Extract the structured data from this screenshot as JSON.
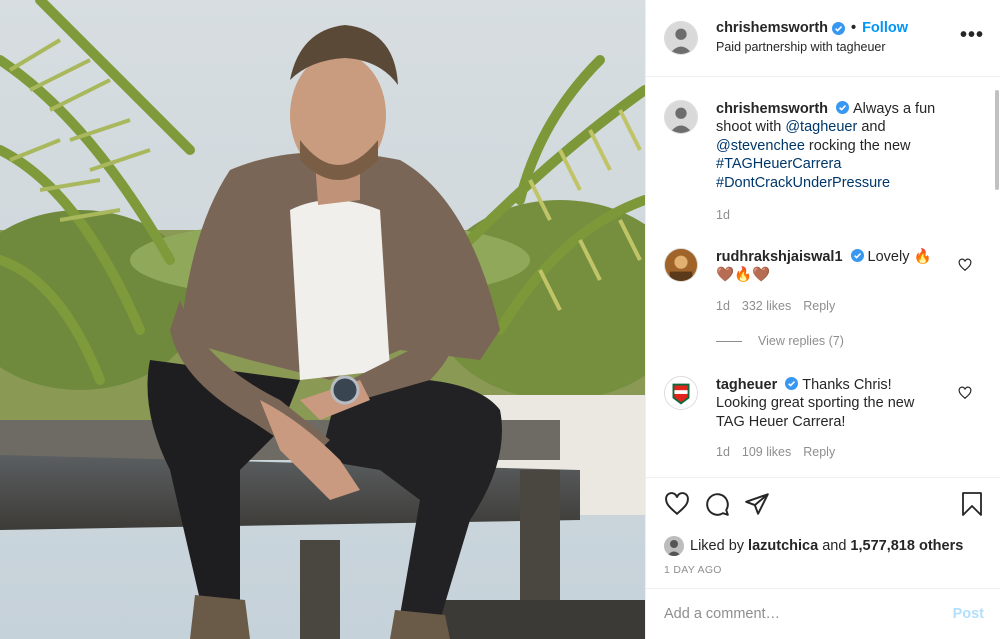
{
  "post": {
    "author": "chrishemsworth",
    "follow_label": "Follow",
    "dot": "•",
    "partnership": "Paid partnership with tagheuer",
    "more_label": "•••",
    "photo_alt": "Man seated on wooden bench with palm trees behind"
  },
  "caption": {
    "username": "chrishemsworth",
    "text_1": "Always a fun shoot with ",
    "mention_1": "@tagheuer",
    "text_2": " and ",
    "mention_2": "@stevenchee",
    "text_3": " rocking the new ",
    "hashtag_1": "#TAGHeuerCarrera",
    "hashtag_2": "#DontCrackUnderPressure",
    "age": "1d"
  },
  "comments": [
    {
      "username": "rudhrakshjaiswal1",
      "text": "Lovely 🔥",
      "text_line2": "🤎🔥🤎",
      "age": "1d",
      "likes": "332 likes",
      "reply": "Reply"
    },
    {
      "username": "tagheuer",
      "text": "Thanks Chris! Looking great sporting the new TAG Heuer Carrera!",
      "age": "1d",
      "likes": "109 likes",
      "reply": "Reply"
    }
  ],
  "view_replies": "View replies (7)",
  "likes": {
    "prefix": "Liked by ",
    "user": "lazutchica",
    "middle": " and ",
    "others": "1,577,818 others"
  },
  "time_ago": "1 DAY AGO",
  "add_comment": {
    "placeholder": "Add a comment…",
    "post_label": "Post"
  },
  "colors": {
    "accent": "#0095f6",
    "link": "#00376b",
    "muted": "#8e8e8e",
    "post_disabled": "#b2dffc"
  }
}
